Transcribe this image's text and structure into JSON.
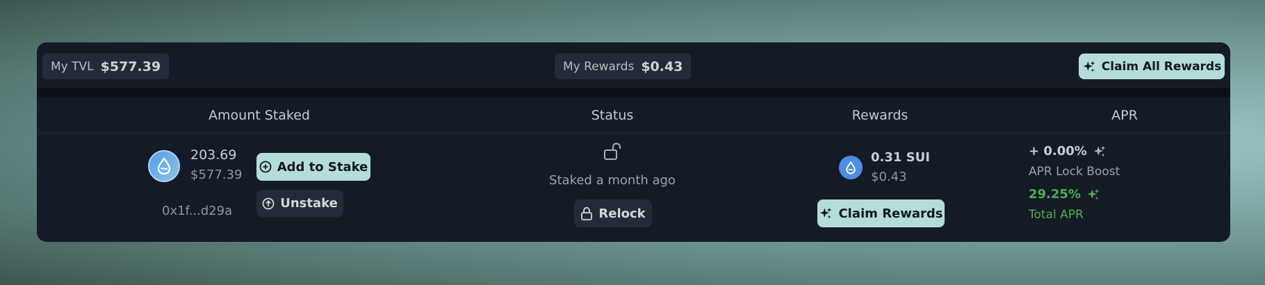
{
  "summary": {
    "tvl_label": "My TVL",
    "tvl_value": "$577.39",
    "rewards_label": "My Rewards",
    "rewards_value": "$0.43",
    "claim_all_label": "Claim All Rewards"
  },
  "table": {
    "headers": [
      "Amount Staked",
      "Status",
      "Rewards",
      "APR"
    ],
    "row": {
      "amount": "203.69",
      "amount_usd": "$577.39",
      "address": "0x1f...d29a",
      "add_to_stake_label": "Add to Stake",
      "unstake_label": "Unstake",
      "status_text": "Staked a month ago",
      "relock_label": "Relock",
      "reward_amount": "0.31 SUI",
      "reward_usd": "$0.43",
      "claim_rewards_label": "Claim Rewards",
      "apr_boost_value": "+ 0.00%",
      "apr_boost_label": "APR Lock Boost",
      "total_apr_value": "29.25%",
      "total_apr_label": "Total APR"
    }
  },
  "icons": {
    "sparkle": "sparkles-icon",
    "coin": "sui-coin-icon",
    "plus": "plus-circle-icon",
    "up": "arrow-up-circle-icon",
    "unlock": "unlock-icon",
    "lock": "lock-icon"
  },
  "colors": {
    "accent": "#b4dcd8",
    "card": "#141b27",
    "green": "#4caf50",
    "sui_blue": "#4b8ee8"
  }
}
